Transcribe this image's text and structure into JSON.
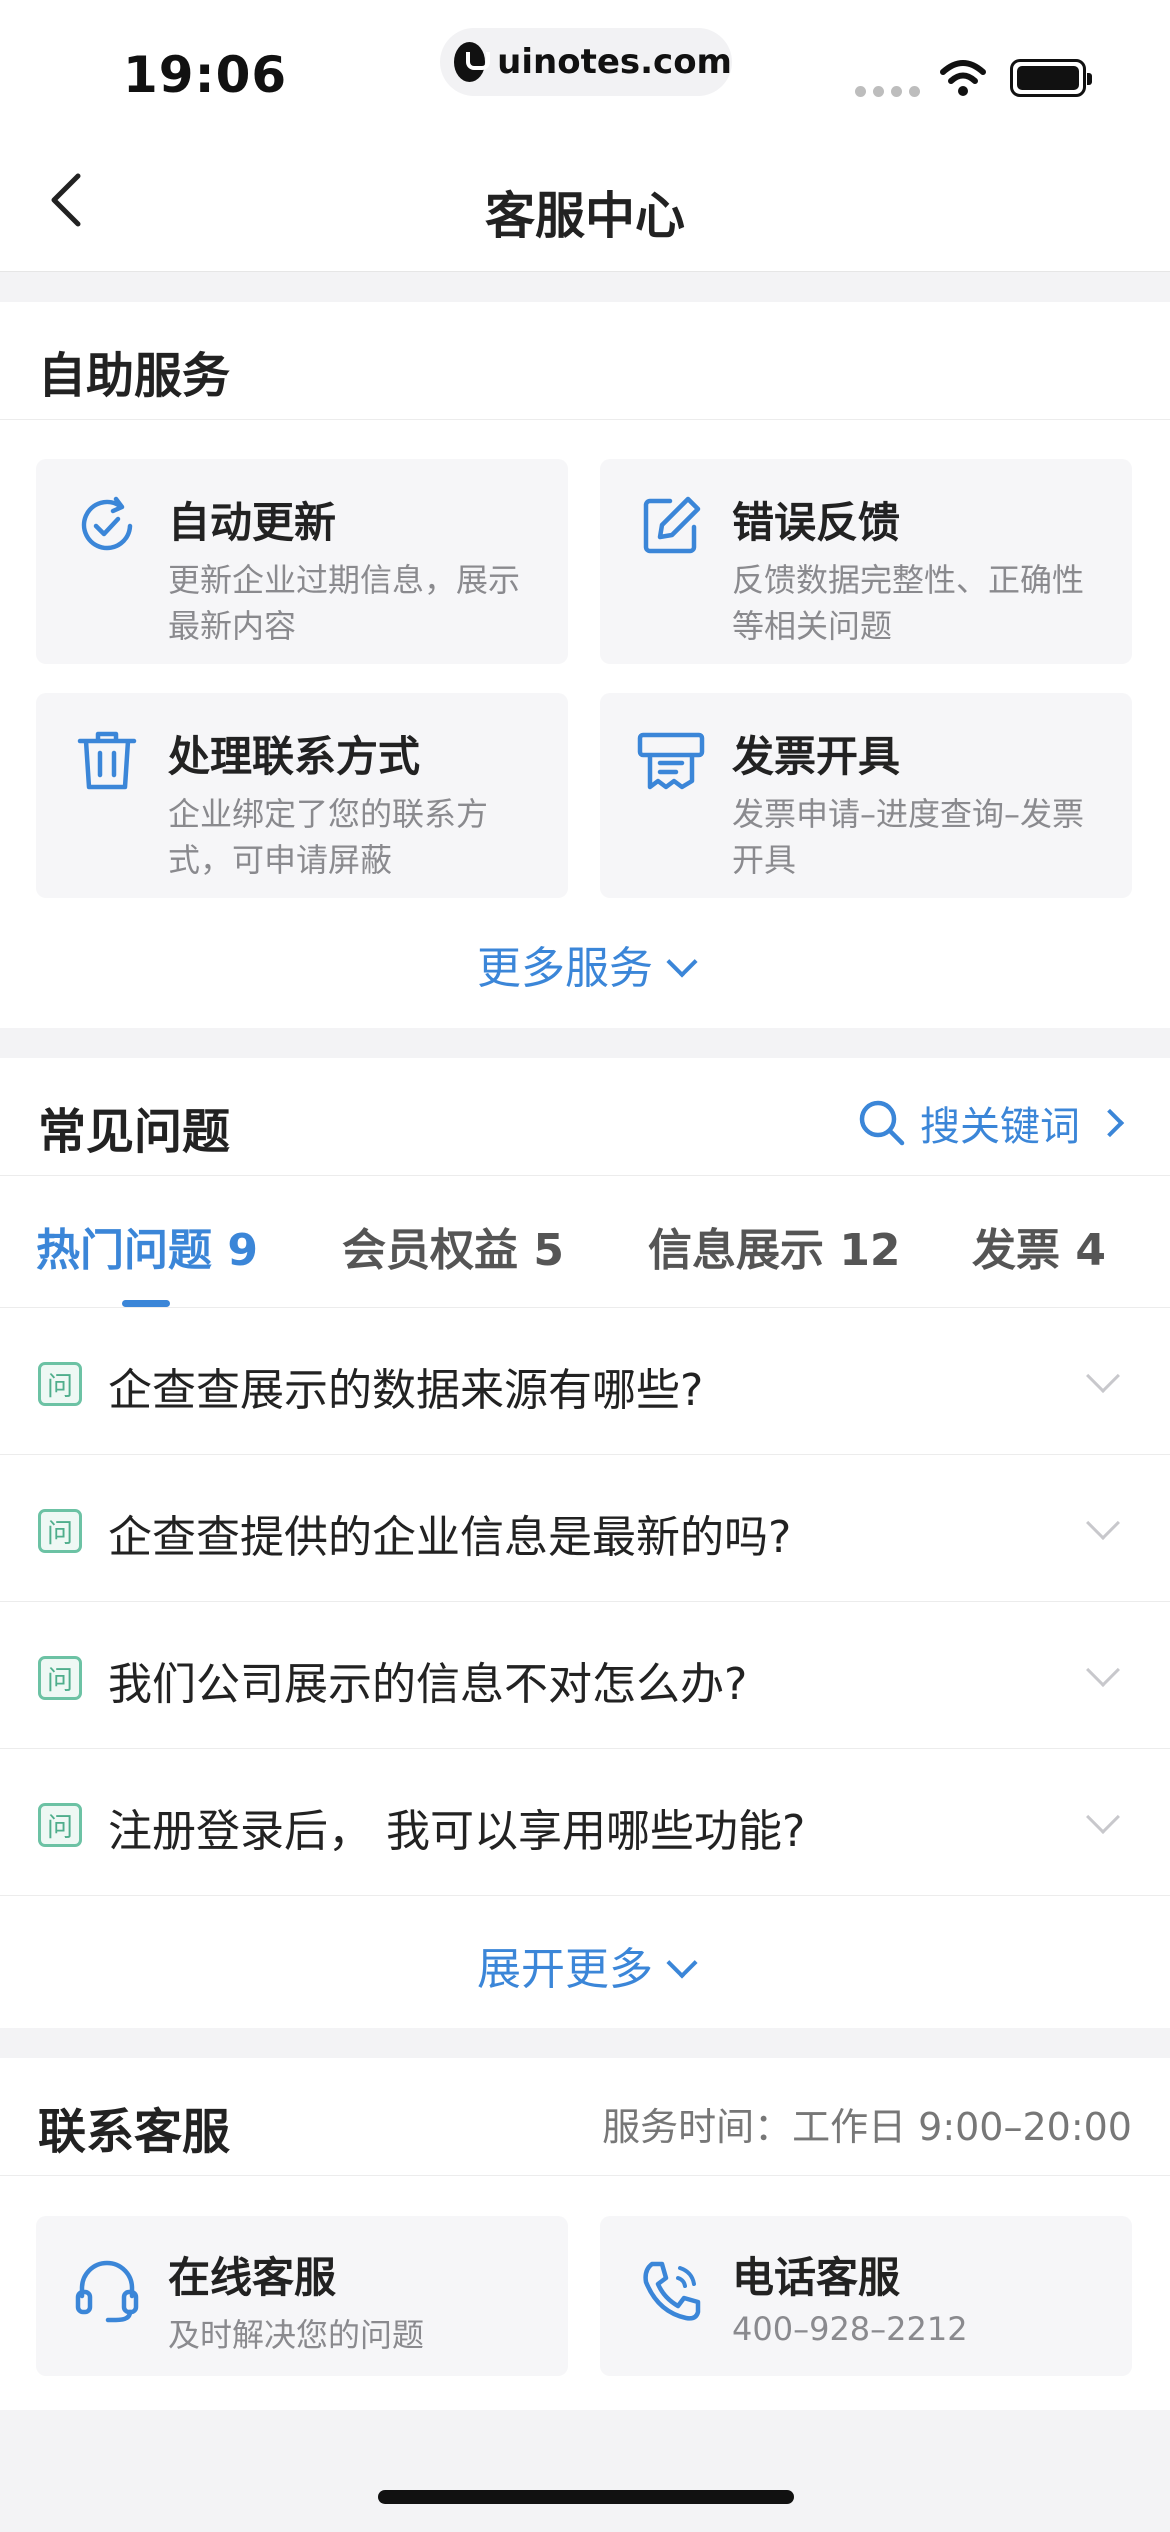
{
  "status_bar": {
    "time": "19:06",
    "url": "uinotes.com"
  },
  "nav": {
    "title": "客服中心",
    "back_icon": "chevron-left-icon"
  },
  "self_service": {
    "title": "自助服务",
    "cards": [
      {
        "title": "自动更新",
        "desc": "更新企业过期信息，展示最新内容",
        "icon": "refresh-check-icon"
      },
      {
        "title": "错误反馈",
        "desc": "反馈数据完整性、正确性等相关问题",
        "icon": "edit-icon"
      },
      {
        "title": "处理联系方式",
        "desc": "企业绑定了您的联系方式，可申请屏蔽",
        "icon": "trash-icon"
      },
      {
        "title": "发票开具",
        "desc": "发票申请–进度查询–发票开具",
        "icon": "invoice-icon"
      }
    ],
    "more_label": "更多服务"
  },
  "faq": {
    "title": "常见问题",
    "search_label": "搜关键词",
    "tabs": [
      {
        "label": "热门问题 9",
        "active": true
      },
      {
        "label": "会员权益 5",
        "active": false
      },
      {
        "label": "信息展示 12",
        "active": false
      },
      {
        "label": "发票 4",
        "active": false
      }
    ],
    "badge": "问",
    "items": [
      "企查查展示的数据来源有哪些?",
      "企查查提供的企业信息是最新的吗?",
      "我们公司展示的信息不对怎么办?",
      "注册登录后， 我可以享用哪些功能?"
    ],
    "expand_label": "展开更多"
  },
  "contact": {
    "title": "联系客服",
    "hours": "服务时间：工作日 9:00–20:00",
    "cards": [
      {
        "title": "在线客服",
        "desc": "及时解决您的问题",
        "icon": "headset-icon"
      },
      {
        "title": "电话客服",
        "desc": "400–928–2212",
        "icon": "phone-icon"
      }
    ]
  },
  "colors": {
    "accent": "#3b86d8",
    "badge_green": "#4fae8c",
    "background": "#f3f3f5"
  }
}
